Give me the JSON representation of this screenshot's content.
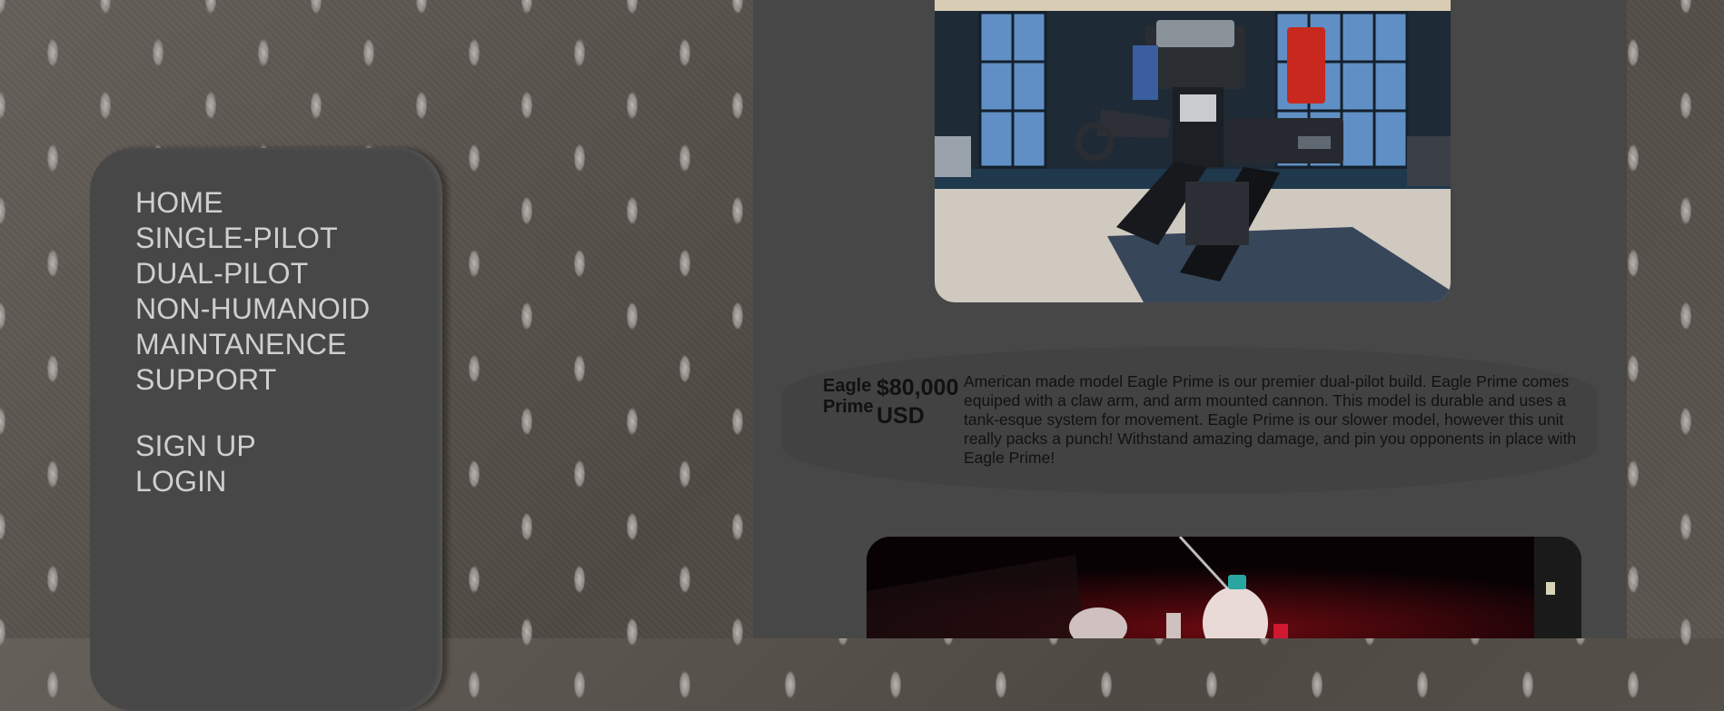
{
  "nav": {
    "primary": [
      "HOME",
      "SINGLE-PILOT",
      "DUAL-PILOT",
      "NON-HUMANOID",
      "MAINTANENCE",
      "SUPPORT"
    ],
    "account": [
      "SIGN UP",
      "LOGIN"
    ]
  },
  "products": [
    {
      "name": "Eagle Prime",
      "price": "$80,000 USD",
      "description": "American made model Eagle Prime is our premier dual-pilot build. Eagle Prime comes equiped with a claw arm, and arm mounted cannon. This model is durable and uses a tank-esque system for movement. Eagle Prime is our slower model, however this unit really packs a punch! Withstand amazing damage, and pin you opponents in place with Eagle Prime!"
    }
  ],
  "colors": {
    "panel": "#474747",
    "nav_text": "#cfcfcf",
    "card": "#424242",
    "text": "#111111"
  }
}
